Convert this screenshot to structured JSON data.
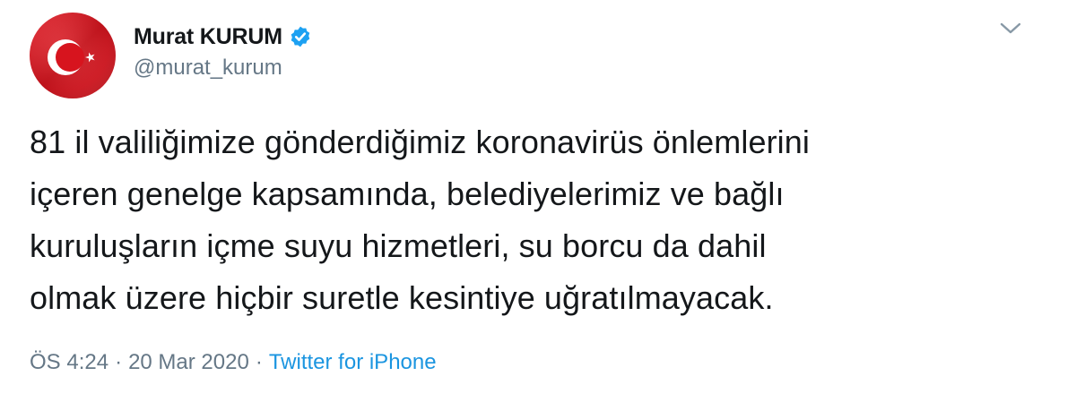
{
  "user": {
    "display_name": "Murat KURUM",
    "handle": "@murat_kurum",
    "verified_icon": "verified-badge-icon",
    "avatar_icon": "turkish-flag-icon"
  },
  "tweet": {
    "lines": [
      "81 il valiliğimize gönderdiğimiz koronavirüs önlemlerini",
      "içeren genelge kapsamında, belediyelerimiz ve bağlı",
      "kuruluşların içme suyu hizmetleri, su borcu da dahil",
      "olmak üzere hiçbir suretle kesintiye uğratılmayacak."
    ]
  },
  "meta": {
    "time": "ÖS 4:24",
    "separator": "·",
    "date": "20 Mar 2020",
    "source": "Twitter for iPhone"
  },
  "menu": {
    "caret_icon": "chevron-down-icon"
  },
  "colors": {
    "verified": "#1da1f2",
    "link": "#1b95e0",
    "secondary_text": "#657786",
    "flag_red": "#e30a17"
  }
}
